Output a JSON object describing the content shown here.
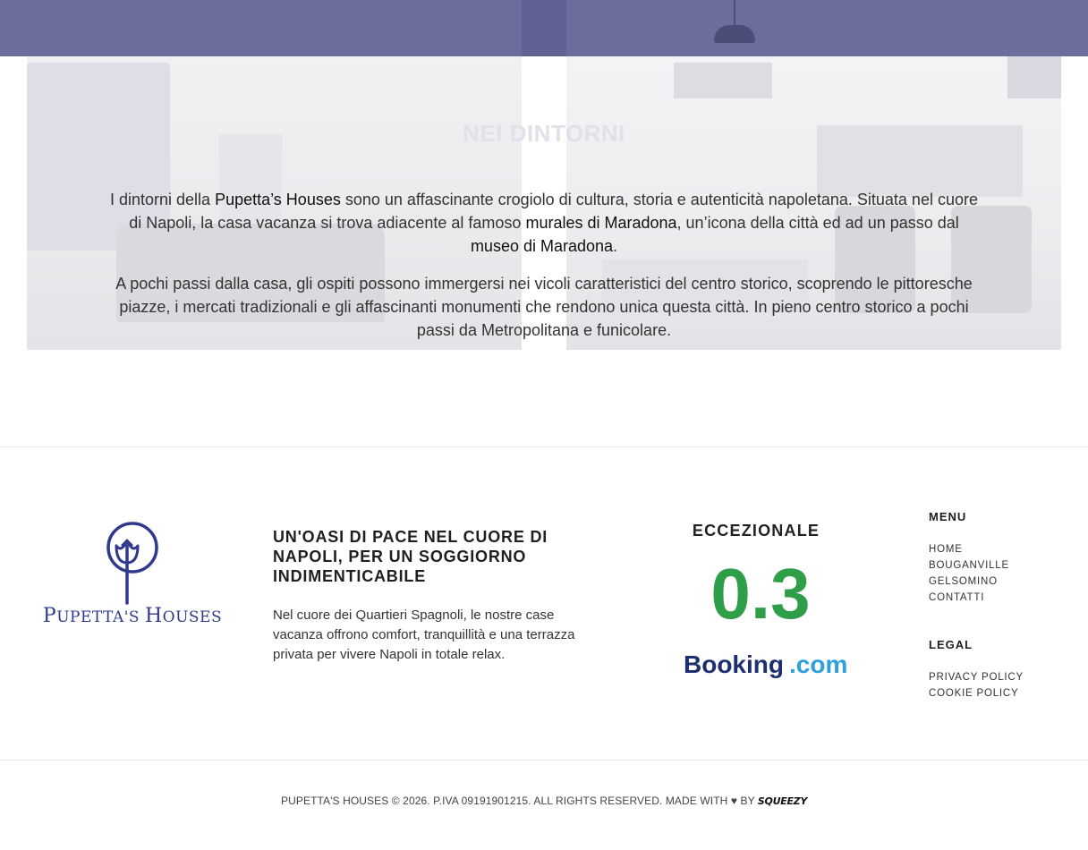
{
  "section": {
    "title": "NEI DINTORNI",
    "p1_a": "I dintorni della ",
    "p1_b": "Pupetta’s Houses",
    "p1_c": " sono un affascinante crogiolo di cultura, storia e autenticità napoletana. Situata nel cuore di Napoli, la casa vacanza si trova adiacente al famoso ",
    "p1_d": "murales di Maradona",
    "p1_e": ", un’icona della città ed ad un passo dal ",
    "p1_f": "museo di Maradona",
    "p1_g": ".",
    "p2": "A pochi passi dalla casa, gli ospiti possono immergersi nei vicoli caratteristici del centro storico, scoprendo le pittoresche piazze, i mercati tradizionali e gli affascinanti monumenti che rendono unica questa città. In pieno centro storico a pochi passi da Metropolitana e funicolare."
  },
  "footer": {
    "logo_first": "P",
    "logo_rest1": "UPETTA'S ",
    "logo_h": "H",
    "logo_rest2": "OUSES",
    "tagline": "UN'OASI DI PACE NEL CUORE DI NAPOLI, PER UN SOGGIORNO INDIMENTICABILE",
    "description": "Nel cuore dei Quartieri Spagnoli, le nostre case vacanza offrono comfort, tranquillità e una terrazza privata per vivere Napoli in totale relax.",
    "rating_label": "ECCEZIONALE",
    "rating_score": "0.3",
    "booking_a": "Booking",
    "booking_b": ".com",
    "menu_title": "MENU",
    "menu_items": [
      "HOME",
      "BOUGANVILLE",
      "GELSOMINO",
      "CONTATTI"
    ],
    "legal_title": "LEGAL",
    "legal_items": [
      "PRIVACY POLICY",
      "COOKIE POLICY"
    ],
    "copyright": "PUPETTA'S HOUSES © 2026. P.IVA 09191901215. ALL RIGHTS RESERVED. MADE WITH ♥ BY ",
    "brand": "SQUEEZY"
  },
  "colors": {
    "nav_bar": "#6b6e9c",
    "logo_blue": "#2f3a8c",
    "rating_green": "#2f9e48",
    "booking_dark": "#1e2f6f",
    "booking_light": "#2aa0dc"
  }
}
